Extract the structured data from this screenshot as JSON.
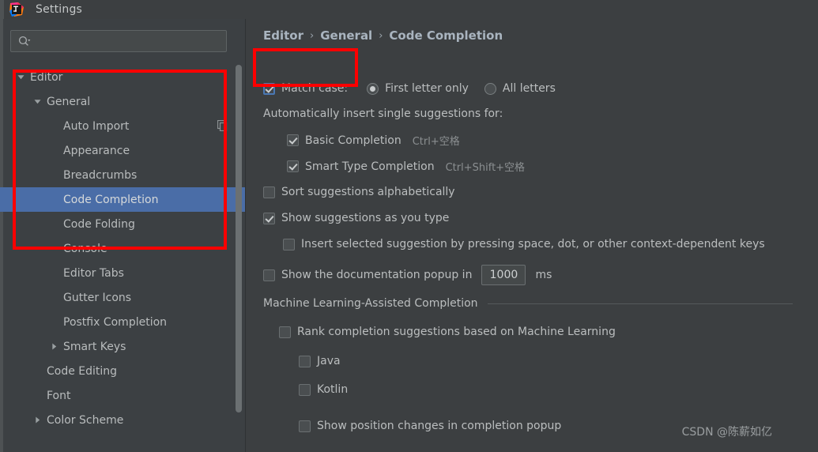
{
  "window": {
    "title": "Settings",
    "logo_icon": "intellij-idea-logo"
  },
  "sidebar": {
    "search": {
      "placeholder": "",
      "value": "",
      "icon": "search-icon",
      "dropdown_icon": "chevron-down-icon"
    },
    "items": [
      {
        "label": "Editor",
        "indent": 0,
        "twisty": "down",
        "selected": false,
        "action_icon": ""
      },
      {
        "label": "General",
        "indent": 1,
        "twisty": "down",
        "selected": false,
        "action_icon": ""
      },
      {
        "label": "Auto Import",
        "indent": 2,
        "twisty": "none",
        "selected": false,
        "action_icon": "copy-icon"
      },
      {
        "label": "Appearance",
        "indent": 2,
        "twisty": "none",
        "selected": false,
        "action_icon": ""
      },
      {
        "label": "Breadcrumbs",
        "indent": 2,
        "twisty": "none",
        "selected": false,
        "action_icon": ""
      },
      {
        "label": "Code Completion",
        "indent": 2,
        "twisty": "none",
        "selected": true,
        "action_icon": ""
      },
      {
        "label": "Code Folding",
        "indent": 2,
        "twisty": "none",
        "selected": false,
        "action_icon": ""
      },
      {
        "label": "Console",
        "indent": 2,
        "twisty": "none",
        "selected": false,
        "action_icon": ""
      },
      {
        "label": "Editor Tabs",
        "indent": 2,
        "twisty": "none",
        "selected": false,
        "action_icon": ""
      },
      {
        "label": "Gutter Icons",
        "indent": 2,
        "twisty": "none",
        "selected": false,
        "action_icon": ""
      },
      {
        "label": "Postfix Completion",
        "indent": 2,
        "twisty": "none",
        "selected": false,
        "action_icon": ""
      },
      {
        "label": "Smart Keys",
        "indent": 2,
        "twisty": "right",
        "selected": false,
        "action_icon": ""
      },
      {
        "label": "Code Editing",
        "indent": 1,
        "twisty": "none",
        "selected": false,
        "action_icon": ""
      },
      {
        "label": "Font",
        "indent": 1,
        "twisty": "none",
        "selected": false,
        "action_icon": ""
      },
      {
        "label": "Color Scheme",
        "indent": 1,
        "twisty": "right",
        "selected": false,
        "action_icon": ""
      }
    ]
  },
  "breadcrumb": {
    "items": [
      "Editor",
      "General",
      "Code Completion"
    ],
    "separator": "›"
  },
  "settings": {
    "match_case": {
      "label": "Match case:",
      "checked": true,
      "options": [
        {
          "label": "First letter only",
          "selected": true
        },
        {
          "label": "All letters",
          "selected": false
        }
      ]
    },
    "auto_insert_heading": "Automatically insert single suggestions for:",
    "auto_insert_items": [
      {
        "label": "Basic Completion",
        "checked": true,
        "shortcut": "Ctrl+空格"
      },
      {
        "label": "Smart Type Completion",
        "checked": true,
        "shortcut": "Ctrl+Shift+空格"
      }
    ],
    "sort_alphabetically": {
      "label": "Sort suggestions alphabetically",
      "checked": false
    },
    "show_as_you_type": {
      "label": "Show suggestions as you type",
      "checked": true
    },
    "insert_selected": {
      "label": "Insert selected suggestion by pressing space, dot, or other context-dependent keys",
      "checked": false
    },
    "doc_popup": {
      "label": "Show the documentation popup in",
      "checked": false,
      "delay_value": "1000",
      "unit": "ms"
    },
    "ml_section": {
      "title": "Machine Learning-Assisted Completion",
      "rank_completion": {
        "label": "Rank completion suggestions based on Machine Learning",
        "checked": false
      },
      "languages": [
        {
          "label": "Java",
          "checked": false
        },
        {
          "label": "Kotlin",
          "checked": false
        }
      ],
      "show_position_changes": {
        "label": "Show position changes in completion popup",
        "checked": false
      }
    }
  },
  "watermark": "CSDN @陈薪如亿",
  "colors": {
    "background": "#3c3f41",
    "sidebar_background": "#3c4043",
    "selection": "#4a6da7",
    "annotation_red": "#fe0000",
    "accent_blue": "#4a78b4"
  }
}
